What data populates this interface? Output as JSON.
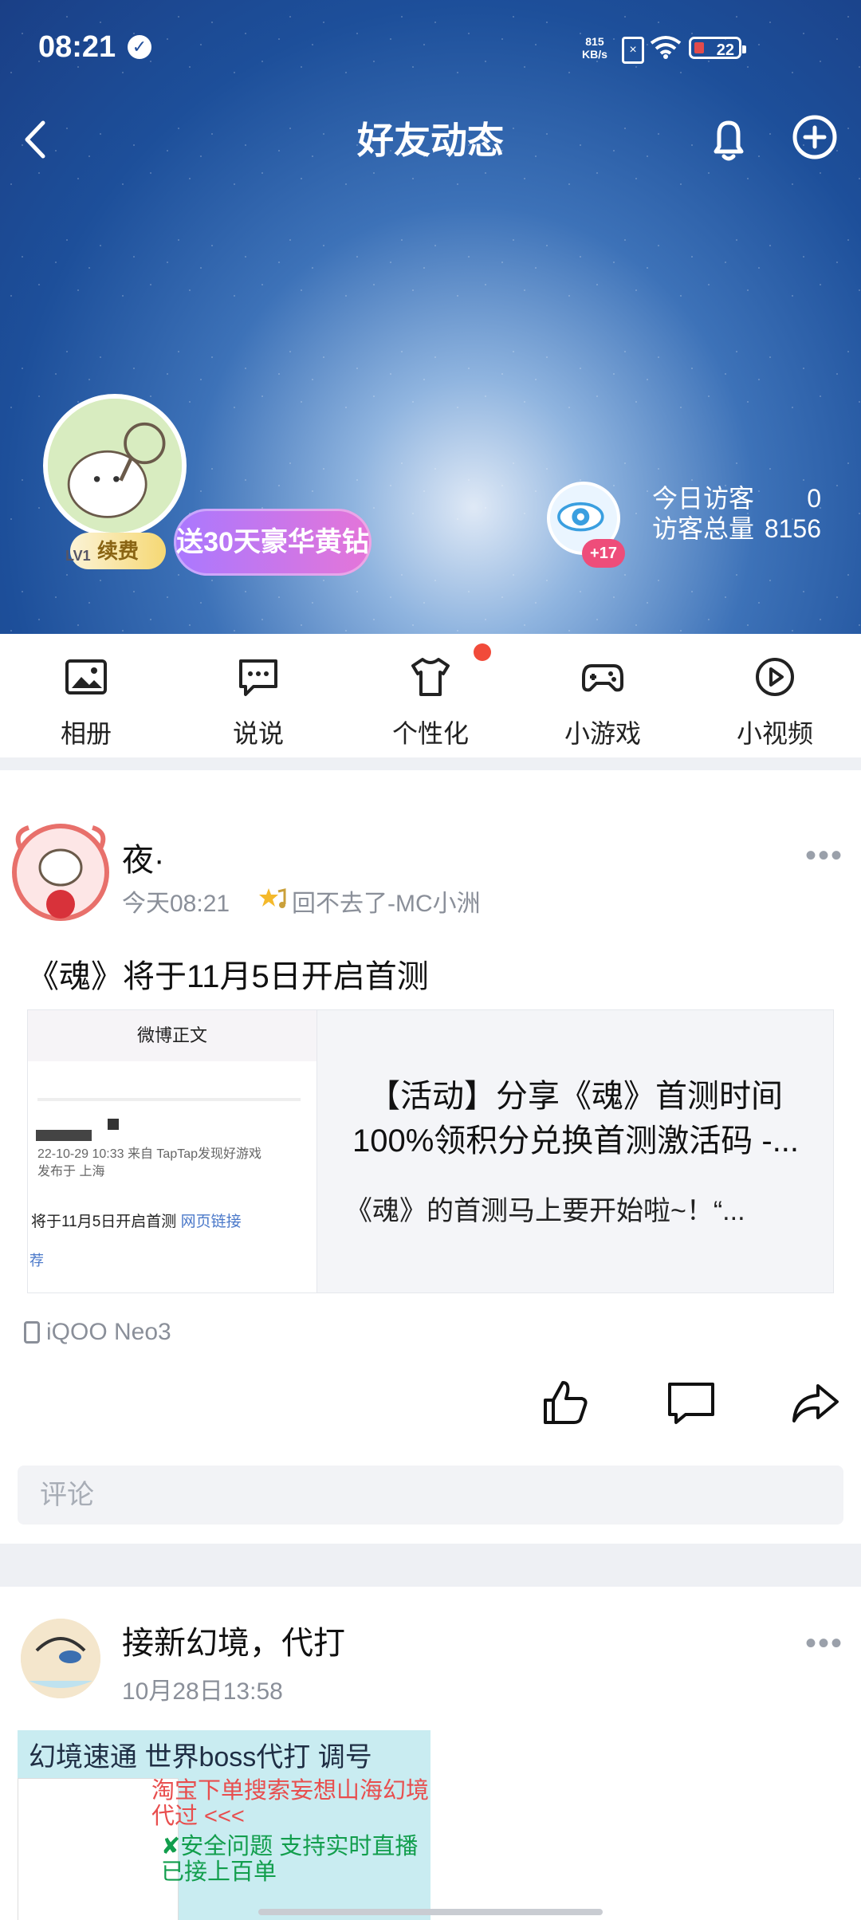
{
  "status_bar": {
    "time": "08:21",
    "net_speed_top": "815",
    "net_speed_bottom": "KB/s",
    "battery": "22"
  },
  "nav": {
    "title": "好友动态"
  },
  "profile": {
    "level": "LV1",
    "renew_label": "续费",
    "promo": "送30天豪华黄钻",
    "eye_badge": "+17",
    "today_visitors_label": "今日访客",
    "today_visitors_value": "0",
    "total_visitors_label": "访客总量",
    "total_visitors_value": "8156"
  },
  "quick_actions": [
    {
      "label": "相册",
      "icon": "photo-album-icon"
    },
    {
      "label": "说说",
      "icon": "chat-bubble-icon"
    },
    {
      "label": "个性化",
      "icon": "tshirt-icon"
    },
    {
      "label": "小游戏",
      "icon": "gamepad-icon"
    },
    {
      "label": "小视频",
      "icon": "play-circle-icon"
    }
  ],
  "post1": {
    "name": "夜·",
    "time": "今天08:21",
    "music": "回不去了-MC小洲",
    "text": "《魂》将于11月5日开启首测",
    "share": {
      "thumb_header": "微博正文",
      "thumb_meta_1": "22-10-29 10:33  来自 TapTap发现好游戏",
      "thumb_meta_2": "发布于 上海",
      "thumb_message": "将于11月5日开启首测",
      "thumb_link": "网页链接",
      "thumb_rec": "荐",
      "title_line1": "【活动】分享《魂》首测时间",
      "title_line2": "100%领积分兑换首测激活码 -...",
      "desc": "《魂》的首测马上要开始啦~！“..."
    },
    "device": "iQOO Neo3",
    "comment_placeholder": "评论"
  },
  "post2": {
    "name": "接新幻境，代打",
    "time": "10月28日13:58",
    "image_title": "幻境速通 世界boss代打  调号",
    "image_red": "淘宝下单搜索妄想山海幻境代过 <<<",
    "image_green": "✘安全问题 支持实时直播 已接上百单"
  },
  "colors": {
    "accent_red": "#f14b3a",
    "eye_badge": "#ee4d7a",
    "promo_start": "#a978ff",
    "promo_end": "#e575d8"
  }
}
